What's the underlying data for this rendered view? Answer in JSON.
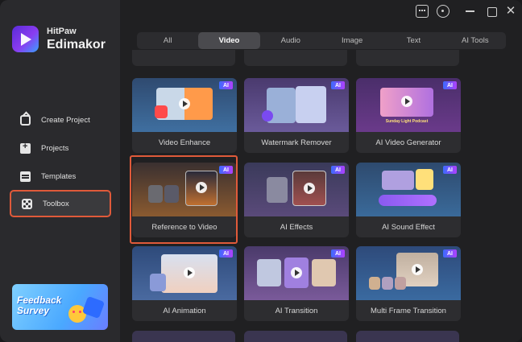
{
  "brand": {
    "top": "HitPaw",
    "name": "Edimakor"
  },
  "window_controls": [
    "chat-icon",
    "help-icon",
    "minimize-icon",
    "maximize-icon",
    "close-icon"
  ],
  "sidebar": {
    "items": [
      {
        "label": "Create Project",
        "icon": "home-plus-icon"
      },
      {
        "label": "Projects",
        "icon": "folder-plus-icon"
      },
      {
        "label": "Templates",
        "icon": "templates-icon"
      },
      {
        "label": "Toolbox",
        "icon": "toolbox-icon",
        "active": true
      }
    ],
    "feedback": {
      "label": "Feedback Survey"
    }
  },
  "tabs": [
    "All",
    "Video",
    "Audio",
    "Image",
    "Text",
    "AI Tools"
  ],
  "active_tab": "Video",
  "badge": "AI",
  "tools": [
    {
      "label": "Video Enhance"
    },
    {
      "label": "Watermark Remover"
    },
    {
      "label": "AI Video Generator",
      "thumb_caption": "Sunday Light Podcast"
    },
    {
      "label": "Reference to Video",
      "selected": true
    },
    {
      "label": "AI Effects"
    },
    {
      "label": "AI Sound Effect"
    },
    {
      "label": "AI Animation"
    },
    {
      "label": "AI Transition"
    },
    {
      "label": "Multi Frame Transition"
    }
  ],
  "colors": {
    "accent_outline": "#e05a3a",
    "ai_badge_start": "#3b6bff",
    "ai_badge_end": "#b040ff"
  }
}
